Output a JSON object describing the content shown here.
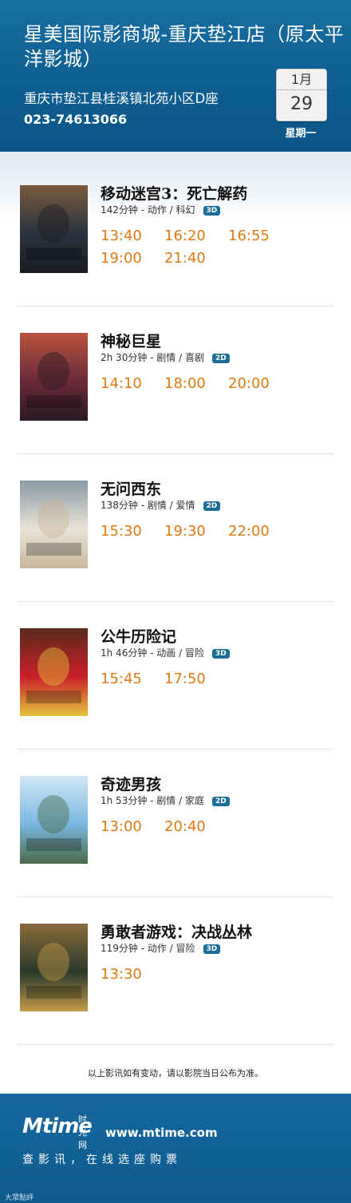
{
  "cinema": {
    "name": "星美国际影商城-重庆垫江店（原太平洋影城）",
    "address": "重庆市垫江县桂溪镇北苑小区D座",
    "phone": "023-74613066"
  },
  "date": {
    "month": "1月",
    "day": "29",
    "weekday": "星期一"
  },
  "movies": [
    {
      "title": "移动迷宫3：死亡解药",
      "meta": "142分钟 - 动作 / 科幻",
      "format": "3D",
      "times": [
        "13:40",
        "16:20",
        "16:55",
        "19:00",
        "21:40"
      ],
      "poster_colors": [
        "#2b3340",
        "#7a5a3c",
        "#1c1c22"
      ],
      "poster_text": "移动迷宫3"
    },
    {
      "title": "神秘巨星",
      "meta": "2h 30分钟 - 剧情 / 喜剧",
      "format": "2D",
      "times": [
        "14:10",
        "18:00",
        "20:00"
      ],
      "poster_colors": [
        "#6b2a3a",
        "#b8533a",
        "#2a1a24"
      ],
      "poster_text": "神秘巨星"
    },
    {
      "title": "无问西东",
      "meta": "138分钟 - 剧情 / 爱情",
      "format": "2D",
      "times": [
        "15:30",
        "19:30",
        "22:00"
      ],
      "poster_colors": [
        "#e8e2d6",
        "#8a9aa5",
        "#c9b89a"
      ],
      "poster_text": "无问西东"
    },
    {
      "title": "公牛历险记",
      "meta": "1h 46分钟 - 动画 / 冒险",
      "format": "3D",
      "times": [
        "15:45",
        "17:50"
      ],
      "poster_colors": [
        "#c8202a",
        "#5a2a1c",
        "#e6c23a"
      ],
      "poster_text": "公牛历险记"
    },
    {
      "title": "奇迹男孩",
      "meta": "1h 53分钟 - 剧情 / 家庭",
      "format": "2D",
      "times": [
        "13:00",
        "20:40"
      ],
      "poster_colors": [
        "#7ab8e0",
        "#cfe6f4",
        "#4a6a4a"
      ],
      "poster_text": "奇迹男孩"
    },
    {
      "title": "勇敢者游戏：决战丛林",
      "meta": "119分钟 - 动作 / 冒险",
      "format": "3D",
      "times": [
        "13:30"
      ],
      "poster_colors": [
        "#2a3a2a",
        "#8a6a3a",
        "#c49a4a"
      ],
      "poster_text": "勇敢者游戏"
    }
  ],
  "notice": "以上影讯如有变动，请以影院当日公布为准。",
  "footer": {
    "brand": "Mtime",
    "brand_cn": "时光网",
    "site": "www.mtime.com",
    "slogan": "查影讯，在线选座购票",
    "watermark": "大眾點評"
  }
}
